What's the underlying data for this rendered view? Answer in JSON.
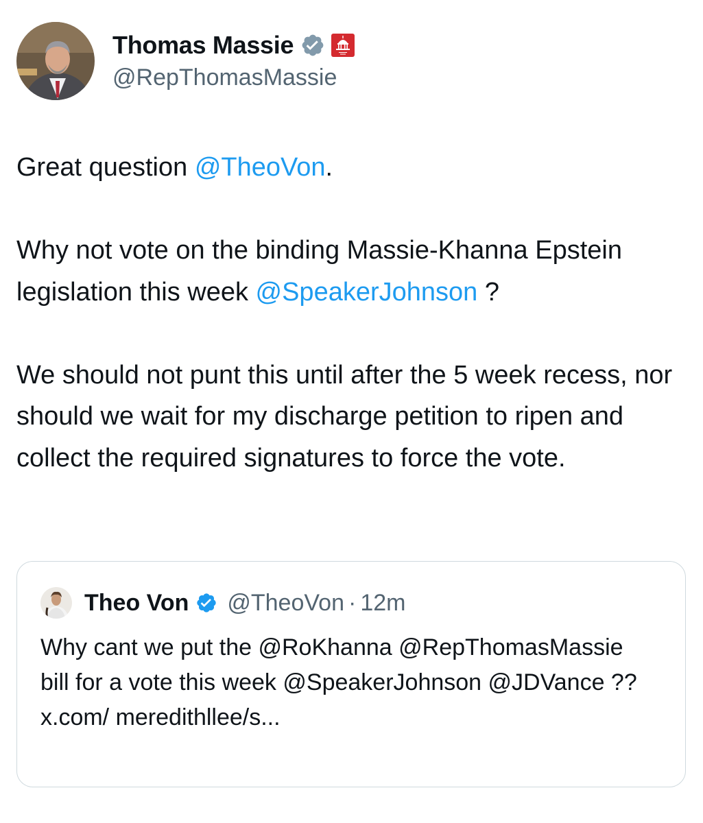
{
  "author": {
    "display_name": "Thomas Massie",
    "handle": "@RepThomasMassie",
    "verified_icon": "verified-badge-gray",
    "affiliation_icon": "us-capitol-gop-badge"
  },
  "tweet": {
    "p1_text": "Great question ",
    "p1_mention": "@TheoVon",
    "p1_end": ".",
    "p2_text_a": "Why not vote on the binding Massie-Khanna Epstein legislation this week ",
    "p2_mention": "@SpeakerJohnson",
    "p2_end": " ?",
    "p3_text": "We should not punt this until after the 5 week recess, nor should we wait for my discharge petition to ripen and collect the required signatures to force the vote."
  },
  "quoted_tweet": {
    "display_name": "Theo Von",
    "handle": "@TheoVon",
    "separator": "·",
    "time": "12m",
    "verified_icon": "verified-badge-blue",
    "text": "Why cant we put the @RoKhanna @RepThomasMassie bill for a vote this week @SpeakerJohnson @JDVance ?? x.com/ meredithllee/s..."
  },
  "colors": {
    "text": "#0f1419",
    "secondary": "#536471",
    "link": "#1d9bf0",
    "border": "#cfd9de",
    "verified_gray": "#829aab",
    "verified_blue": "#1d9bf0",
    "gov_badge": "#d42a2f"
  }
}
